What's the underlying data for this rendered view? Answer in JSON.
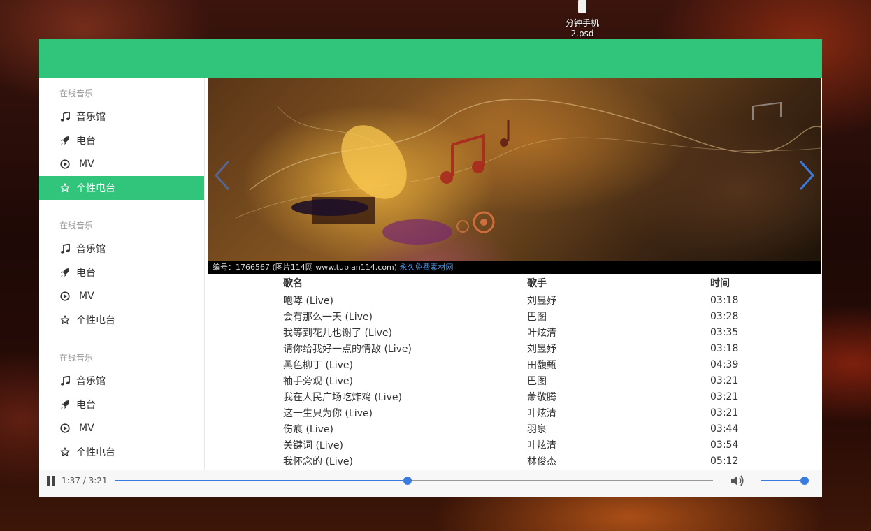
{
  "desktop": {
    "icon_label_line1": "分钟手机",
    "icon_label_line2": "2.psd"
  },
  "sidebar": {
    "groups": [
      {
        "title": "在线音乐",
        "items": [
          {
            "label": "音乐馆",
            "icon": "music-note-icon"
          },
          {
            "label": "电台",
            "icon": "rocket-icon"
          },
          {
            "label": "MV",
            "icon": "play-circle-icon"
          },
          {
            "label": "个性电台",
            "icon": "star-icon",
            "active": true
          }
        ]
      },
      {
        "title": "在线音乐",
        "items": [
          {
            "label": "音乐馆",
            "icon": "music-note-icon"
          },
          {
            "label": "电台",
            "icon": "rocket-icon"
          },
          {
            "label": "MV",
            "icon": "play-circle-icon"
          },
          {
            "label": "个性电台",
            "icon": "star-icon"
          }
        ]
      },
      {
        "title": "在线音乐",
        "items": [
          {
            "label": "音乐馆",
            "icon": "music-note-icon"
          },
          {
            "label": "电台",
            "icon": "rocket-icon"
          },
          {
            "label": "MV",
            "icon": "play-circle-icon"
          },
          {
            "label": "个性电台",
            "icon": "star-icon"
          }
        ]
      }
    ]
  },
  "banner": {
    "caption": "编号：1766567 (图片114网 www.tupian114.com)",
    "caption_highlight": "永久免费素材网"
  },
  "songs": {
    "headers": [
      "歌名",
      "歌手",
      "时间"
    ],
    "rows": [
      [
        "咆哮 (Live)",
        "刘昱妤",
        "03:18"
      ],
      [
        "会有那么一天 (Live)",
        "巴图",
        "03:28"
      ],
      [
        "我等到花儿也谢了 (Live)",
        "叶炫清",
        "03:35"
      ],
      [
        "请你给我好一点的情敌 (Live)",
        "刘昱妤",
        "03:18"
      ],
      [
        "黑色柳丁 (Live)",
        "田馥甄",
        "04:39"
      ],
      [
        "袖手旁观 (Live)",
        "巴图",
        "03:21"
      ],
      [
        "我在人民广场吃炸鸡 (Live)",
        "萧敬腾",
        "03:21"
      ],
      [
        "这一生只为你 (Live)",
        "叶炫清",
        "03:21"
      ],
      [
        "伤痕 (Live)",
        "羽泉",
        "03:44"
      ],
      [
        "关键词 (Live)",
        "叶炫清",
        "03:54"
      ],
      [
        "我怀念的 (Live)",
        "林俊杰",
        "05:12"
      ]
    ]
  },
  "player": {
    "time": "1:37 / 3:21",
    "progress": 0.49,
    "volume": 0.9,
    "accent_color": "#3a7be0"
  },
  "colors": {
    "brand": "#31c47b"
  }
}
